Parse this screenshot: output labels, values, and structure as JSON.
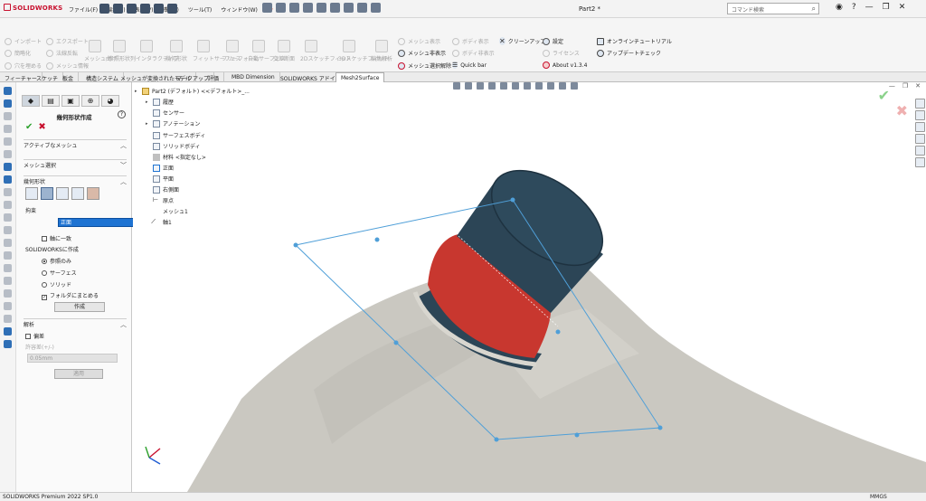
{
  "titlebar": {
    "logo": "SOLIDWORKS",
    "menus": [
      "ファイル(F)",
      "編集(E)",
      "表示(V)",
      "挿入(I)",
      "ツール(T)",
      "ウィンドウ(W)"
    ],
    "document_title": "Part2 *",
    "search_placeholder": "コマンド検索"
  },
  "command_manager": {
    "disabled_small": [
      "インポート",
      "エクスポート",
      "簡略化",
      "法線反転",
      "穴を埋める",
      "メッシュ情報"
    ],
    "disabled_big": [
      "メッシュ曲げ",
      "参照形状列",
      "インタラクティブ",
      "幾何形状",
      "フィットサーフェス",
      "フリーフォーム",
      "自動サーフェス",
      "交差断面",
      "2Dスケッチフィット",
      "3Dスケッチフィット"
    ],
    "edit_surface": "編集解析",
    "mesh_group": {
      "show": "メッシュ表示",
      "hide": "メッシュ非表示",
      "release": "メッシュ選択解除"
    },
    "body_group": {
      "show": "ボディ表示",
      "hide": "ボディ非表示",
      "quickbar": "Quick bar"
    },
    "cleanup": "クリーンアップ",
    "settings": "設定",
    "license": "ライセンス",
    "about": "About v1.3.4",
    "tutorial": "オンラインチュートリアル",
    "update": "アップデートチェック"
  },
  "tabs": [
    "フィーチャー",
    "スケッチ",
    "板金",
    "構造システム",
    "メッシュが変換されたモデル",
    "マークアップ",
    "評価",
    "MBD Dimension",
    "SOLIDWORKS アドイン",
    "Mesh2Surface"
  ],
  "active_tab": "Mesh2Surface",
  "property_manager": {
    "title": "幾何形状作成",
    "sec_active_mesh": "アクティブなメッシュ",
    "sec_mesh_select": "メッシュ選択",
    "sec_geometry": "幾何形状",
    "constraint": "拘束",
    "face_value": "正面",
    "axis_match": "軸に一致",
    "create_in_sw": "SOLIDWORKSに作成",
    "radio_ref": "参照のみ",
    "radio_surface": "サーフェス",
    "radio_solid": "ソリッド",
    "folder": "フォルダにまとめる",
    "create_button": "作成",
    "analysis": "解析",
    "deviation": "偏差",
    "tolerance_label": "許容差(+/-)",
    "tolerance_value": "0.05mm",
    "apply_button": "適用"
  },
  "tree": {
    "root": "Part2 (デフォルト) <<デフォルト>_...",
    "items": [
      "履歴",
      "センサー",
      "アノテーション",
      "サーフェスボディ",
      "ソリッドボディ",
      "材料 <指定なし>",
      "正面",
      "平面",
      "右側面",
      "原点",
      "メッシュ1",
      "軸1"
    ]
  },
  "status": {
    "left": "SOLIDWORKS Premium 2022 SP1.0",
    "units": "MMGS"
  },
  "colors": {
    "cap": "#2c4556",
    "red_band": "#c8372f",
    "bottle": "#c9c7c0",
    "plane": "#4f9fd8",
    "accent": "#1e73d2"
  }
}
